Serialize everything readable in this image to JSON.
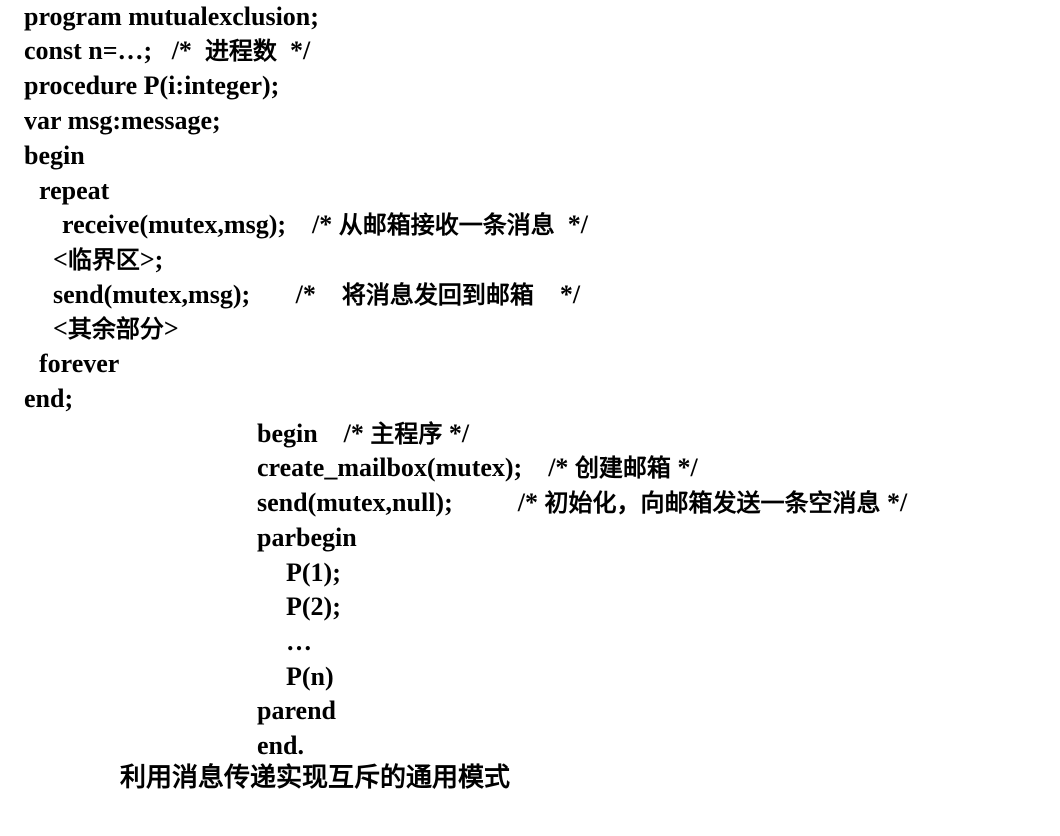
{
  "process": {
    "line1": "program mutualexclusion;",
    "line2_code": "const n=…;   /*  ",
    "line2_comment": "进程数",
    "line2_end": "  */",
    "line3": "procedure P(i:integer);",
    "line4": "var msg:message;",
    "line5": "begin",
    "line6": "repeat",
    "line7_code": "receive(mutex,msg);    /* ",
    "line7_comment": "从邮箱接收一条消息",
    "line7_end": "  */",
    "line8_lt": "<",
    "line8_comment": "临界区",
    "line8_end": ">;",
    "line9_code": "send(mutex,msg);       /*    ",
    "line9_comment": "将消息发回到邮箱",
    "line9_end": "    */",
    "line10_lt": "<",
    "line10_comment": "其余部分",
    "line10_end": ">",
    "line11": "forever",
    "line12": "end;"
  },
  "main": {
    "line1_code": "begin    /* ",
    "line1_comment": "主程序",
    "line1_end": " */",
    "line2_code": "create_mailbox(mutex);    /* ",
    "line2_comment": "创建邮箱",
    "line2_end": " */",
    "line3_code": "send(mutex,null);          /* ",
    "line3_comment": "初始化，向邮箱发送一条空消息",
    "line3_end": " */",
    "line4": "parbegin",
    "line5": "P(1);",
    "line6": "P(2);",
    "line7": "…",
    "line8": "P(n)",
    "line9": "parend",
    "line10": "end."
  },
  "caption": "利用消息传递实现互斥的通用模式"
}
